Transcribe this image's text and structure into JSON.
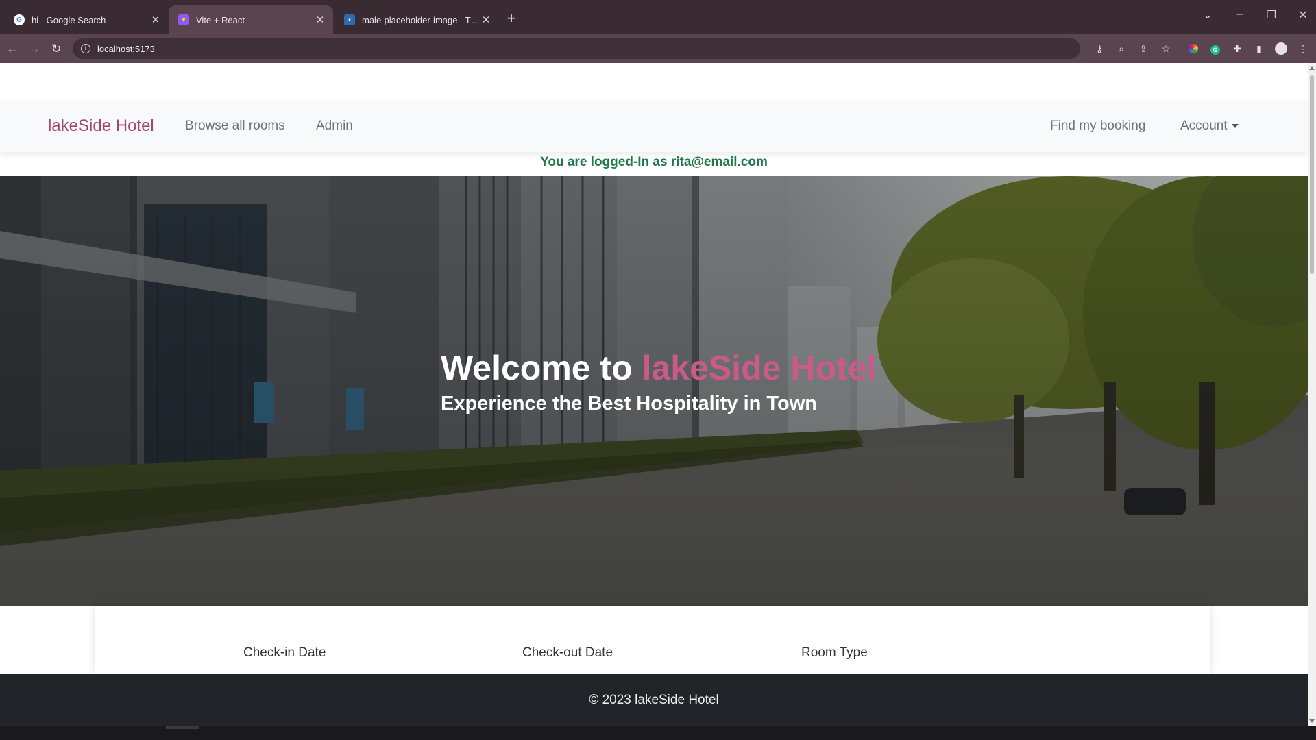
{
  "browser": {
    "tabs": [
      {
        "title": "hi - Google Search",
        "favicon": "google-icon",
        "active": false
      },
      {
        "title": "Vite + React",
        "favicon": "vite-icon",
        "active": true
      },
      {
        "title": "male-placeholder-image - The N",
        "favicon": "page-icon",
        "active": false
      }
    ],
    "new_tab_label": "+",
    "url": "localhost:5173"
  },
  "navbar": {
    "brand": "lakeSide Hotel",
    "links": {
      "browse": "Browse all rooms",
      "admin": "Admin",
      "find_booking": "Find my booking",
      "account": "Account"
    }
  },
  "login_message": "You are logged-In as rita@email.com",
  "hero": {
    "title_prefix": "Welcome to ",
    "title_accent": "lakeSide Hotel",
    "subtitle": "Experience the Best Hospitality in Town"
  },
  "search": {
    "checkin_label": "Check-in Date",
    "checkout_label": "Check-out Date",
    "room_type_label": "Room Type"
  },
  "footer": {
    "text": "© 2023 lakeSide Hotel"
  },
  "colors": {
    "brand": "#a3466f",
    "accent": "#c95a8a",
    "login_message": "#1f7a4a",
    "footer_bg": "#212529"
  }
}
